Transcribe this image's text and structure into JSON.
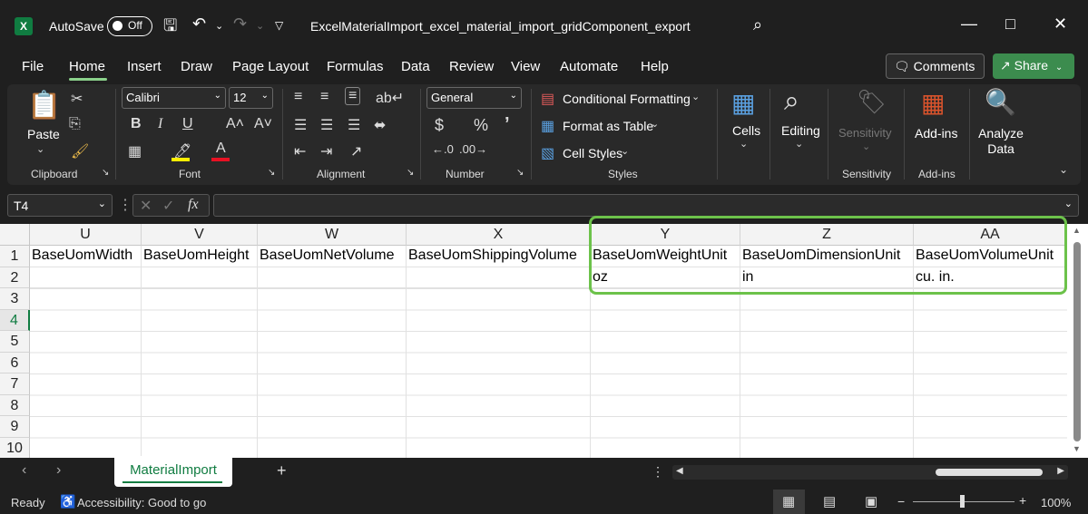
{
  "titlebar": {
    "autosave_label": "AutoSave",
    "autosave_state": "Off",
    "file_title": "ExcelMaterialImport_excel_material_import_gridComponent_export"
  },
  "menu": {
    "tabs": [
      "File",
      "Home",
      "Insert",
      "Draw",
      "Page Layout",
      "Formulas",
      "Data",
      "Review",
      "View",
      "Automate",
      "Help"
    ],
    "active_tab": "Home",
    "comments_label": "Comments",
    "share_label": "Share"
  },
  "ribbon": {
    "clipboard": {
      "paste_label": "Paste",
      "group_label": "Clipboard"
    },
    "font": {
      "font_name": "Calibri",
      "font_size": "12",
      "group_label": "Font"
    },
    "alignment": {
      "group_label": "Alignment"
    },
    "number": {
      "format": "General",
      "group_label": "Number"
    },
    "styles": {
      "conditional_formatting": "Conditional Formatting",
      "format_as_table": "Format as Table",
      "cell_styles": "Cell Styles",
      "group_label": "Styles"
    },
    "cells_label": "Cells",
    "editing_label": "Editing",
    "sensitivity": {
      "button_label": "Sensitivity",
      "group_label": "Sensitivity"
    },
    "addins": {
      "button_label": "Add-ins",
      "group_label": "Add-ins"
    },
    "analyze_data_label": "Analyze Data"
  },
  "formula_bar": {
    "name_box": "T4",
    "fx_label": "fx",
    "formula_value": ""
  },
  "grid": {
    "columns": [
      "U",
      "V",
      "W",
      "X",
      "Y",
      "Z",
      "AA"
    ],
    "rows": [
      "1",
      "2",
      "3",
      "4",
      "5",
      "6",
      "7",
      "8",
      "9",
      "10"
    ],
    "active_row": "4",
    "row1": [
      "BaseUomWidth",
      "BaseUomHeight",
      "BaseUomNetVolume",
      "BaseUomShippingVolume",
      "BaseUomWeightUnit",
      "BaseUomDimensionUnit",
      "BaseUomVolumeUnit"
    ],
    "row2": [
      "",
      "",
      "",
      "",
      "oz",
      "in",
      "cu. in."
    ]
  },
  "sheet_tabs": {
    "active": "MaterialImport",
    "add_label": "+"
  },
  "statusbar": {
    "ready": "Ready",
    "accessibility": "Accessibility: Good to go",
    "zoom": "100%"
  },
  "colors": {
    "accent_green": "#107c41",
    "highlight_box": "#6cc24a",
    "share_green": "#3c8c4e"
  }
}
